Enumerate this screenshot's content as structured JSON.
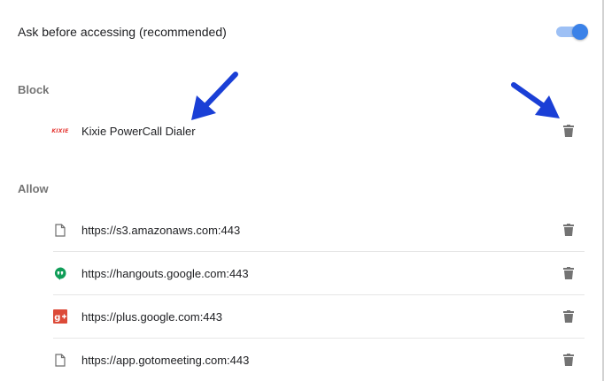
{
  "setting": {
    "label": "Ask before accessing (recommended)",
    "toggle_on": true
  },
  "block": {
    "heading": "Block",
    "items": [
      {
        "label": "Kixie PowerCall Dialer",
        "icon": "kixie-logo",
        "logo_text": "KIXIE"
      }
    ]
  },
  "allow": {
    "heading": "Allow",
    "items": [
      {
        "label": "https://s3.amazonaws.com:443",
        "icon": "file-icon"
      },
      {
        "label": "https://hangouts.google.com:443",
        "icon": "hangouts-icon"
      },
      {
        "label": "https://plus.google.com:443",
        "icon": "google-plus-icon"
      },
      {
        "label": "https://app.gotomeeting.com:443",
        "icon": "file-icon"
      }
    ]
  },
  "colors": {
    "toggle_knob": "#3b82e8",
    "toggle_track": "#9dc0f5",
    "annotation_arrow": "#1a3fd6",
    "trash": "#737373"
  }
}
